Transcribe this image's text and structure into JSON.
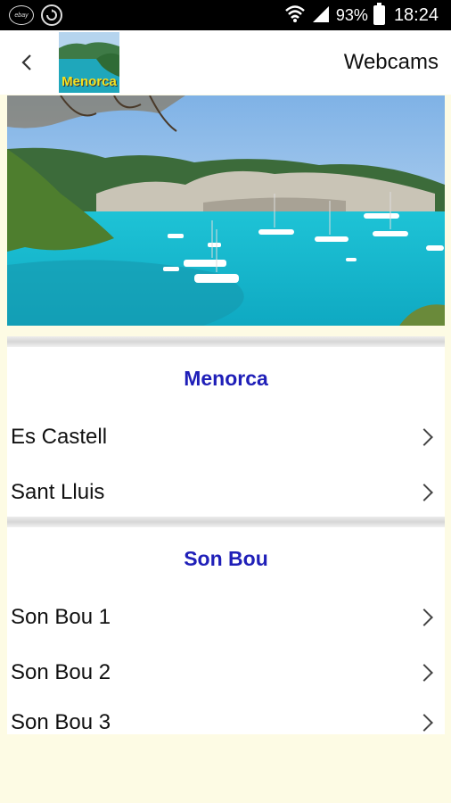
{
  "status_bar": {
    "ebay_label": "ebay",
    "battery": "93%",
    "time": "18:24"
  },
  "app_bar": {
    "logo_text": "Menorca",
    "title": "Webcams"
  },
  "sections": [
    {
      "header": "Menorca",
      "items": [
        {
          "label": "Es Castell"
        },
        {
          "label": "Sant Lluis"
        }
      ]
    },
    {
      "header": "Son Bou",
      "items": [
        {
          "label": "Son Bou 1"
        },
        {
          "label": "Son Bou 2"
        },
        {
          "label": "Son Bou 3"
        }
      ]
    }
  ],
  "colors": {
    "section_header": "#1f1fb8",
    "page_bg": "#fdfbe4"
  }
}
